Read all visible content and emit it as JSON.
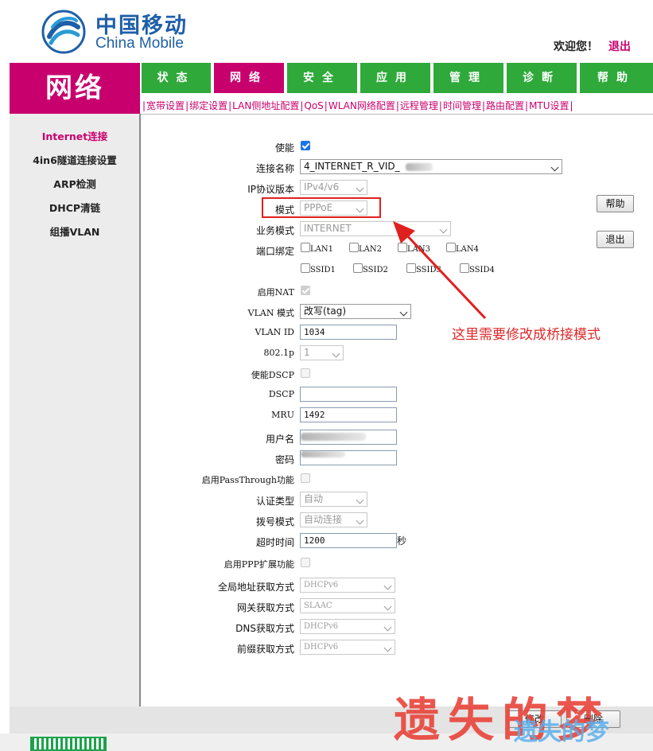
{
  "header": {
    "logo_cn": "中国移动",
    "logo_en": "China Mobile",
    "welcome": "欢迎您！",
    "logout": "退出"
  },
  "section_title": "网络",
  "nav": {
    "tabs": [
      "状态",
      "网络",
      "安全",
      "应用",
      "管理",
      "诊断",
      "帮助"
    ],
    "active_index": 1
  },
  "subnav": [
    "宽带设置",
    "绑定设置",
    "LAN侧地址配置",
    "QoS",
    "WLAN网络配置",
    "远程管理",
    "时间管理",
    "路由配置",
    "MTU设置"
  ],
  "sidebar": {
    "items": [
      "Internet连接",
      "4in6隧道连接设置",
      "ARP检测",
      "DHCP清链",
      "组播VLAN"
    ],
    "active_index": 0
  },
  "form": {
    "enable": {
      "label": "使能",
      "checked": true
    },
    "conn_name": {
      "label": "连接名称",
      "value": "4_INTERNET_R_VID_"
    },
    "ip_version": {
      "label": "IP协议版本",
      "value": "IPv4/v6"
    },
    "mode": {
      "label": "模式",
      "value": "PPPoE"
    },
    "service_mode": {
      "label": "业务模式",
      "value": "INTERNET"
    },
    "port_bind": {
      "label": "端口绑定",
      "ports": [
        "LAN1",
        "LAN2",
        "LAN3",
        "LAN4",
        "SSID1",
        "SSID2",
        "SSID3",
        "SSID4"
      ]
    },
    "nat": {
      "label": "启用NAT",
      "checked": true
    },
    "vlan_mode": {
      "label": "VLAN 模式",
      "value": "改写(tag)"
    },
    "vlan_id": {
      "label": "VLAN ID",
      "value": "1034"
    },
    "dot1p": {
      "label": "802.1p",
      "value": "1"
    },
    "dscp_enable": {
      "label": "使能DSCP"
    },
    "dscp": {
      "label": "DSCP",
      "value": ""
    },
    "mru": {
      "label": "MRU",
      "value": "1492"
    },
    "username": {
      "label": "用户名"
    },
    "password": {
      "label": "密码"
    },
    "passthrough": {
      "label": "启用PassThrough功能"
    },
    "auth_type": {
      "label": "认证类型",
      "value": "自动"
    },
    "dial_mode": {
      "label": "拨号模式",
      "value": "自动连接"
    },
    "timeout": {
      "label": "超时时间",
      "value": "1200",
      "unit": "秒"
    },
    "ppp_ext": {
      "label": "启用PPP扩展功能"
    },
    "global_addr": {
      "label": "全局地址获取方式",
      "value": "DHCPv6"
    },
    "gateway": {
      "label": "网关获取方式",
      "value": "SLAAC"
    },
    "dns": {
      "label": "DNS获取方式",
      "value": "DHCPv6"
    },
    "prefix": {
      "label": "前缀获取方式",
      "value": "DHCPv6"
    }
  },
  "buttons": {
    "help": "帮助",
    "exit": "退出",
    "modify": "修改",
    "delete": "删除"
  },
  "annotation": {
    "text": "这里需要修改成桥接模式",
    "color": "#e02020"
  },
  "watermark": {
    "main": "遗失的梦",
    "secondary": "遗失的梦"
  },
  "colors": {
    "brand": "#c8006e",
    "nav_green": "#2ea93a",
    "logo_blue": "#1f5fa8"
  }
}
